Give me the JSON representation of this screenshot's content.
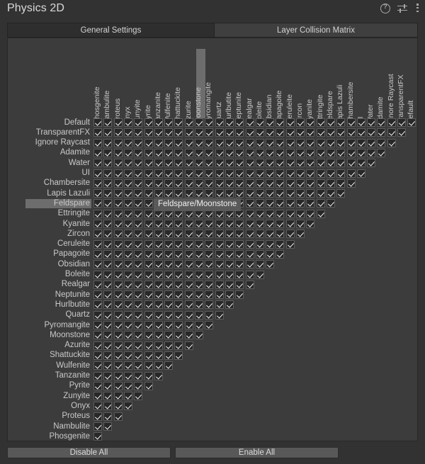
{
  "window": {
    "title": "Physics 2D",
    "icons": [
      {
        "name": "help-icon",
        "glyph": "?"
      },
      {
        "name": "preset-sliders-icon",
        "glyph": "sliders"
      },
      {
        "name": "more-options-kebab-icon",
        "glyph": "kebab"
      }
    ]
  },
  "tabs": [
    {
      "label": "General Settings",
      "active": false
    },
    {
      "label": "Layer Collision Matrix",
      "active": true
    }
  ],
  "matrix": {
    "row_labels": [
      "Default",
      "TransparentFX",
      "Ignore Raycast",
      "Adamite",
      "Water",
      "UI",
      "Chambersite",
      "Lapis Lazuli",
      "Feldspare",
      "Ettringite",
      "Kyanite",
      "Zircon",
      "Ceruleite",
      "Papagoite",
      "Obsidian",
      "Boleite",
      "Realgar",
      "Neptunite",
      "Hurlbutite",
      "Quartz",
      "Pyromangite",
      "Moonstone",
      "Azurite",
      "Shattuckite",
      "Wulfenite",
      "Tanzanite",
      "Pyrite",
      "Zunyite",
      "Onyx",
      "Proteus",
      "Nambulite",
      "Phosgenite"
    ],
    "column_labels": [
      "Phosgenite",
      "Nambulite",
      "Proteus",
      "Onyx",
      "Zunyite",
      "Pyrite",
      "Tanzanite",
      "Wulfenite",
      "Shattuckite",
      "Azurite",
      "Moonstone",
      "Pyromangite",
      "Quartz",
      "Hurlbutite",
      "Neptunite",
      "Realgar",
      "Boleite",
      "Obsidian",
      "Papagoite",
      "Ceruleite",
      "Zircon",
      "Kyanite",
      "Ettringite",
      "Feldspare",
      "Lapis Lazuli",
      "Chambersite",
      "UI",
      "Water",
      "Adamite",
      "Ignore Raycast",
      "TransparentFX",
      "Default"
    ],
    "all_checked": true,
    "highlighted_row": "Feldspare",
    "highlighted_column": "Moonstone",
    "tooltip": "Feldspare/Moonstone",
    "checkbox_state": "checked"
  },
  "footer": {
    "disable_all_label": "Disable All",
    "enable_all_label": "Enable All"
  },
  "colors": {
    "window_bg": "#323232",
    "panel_bg": "#3c3c3c",
    "tab_active": "#3f3f3f",
    "tab_inactive": "#2e2e2e",
    "highlight": "#6d6d6d",
    "checkbox_bg": "#282828",
    "text": "#c9c9c9",
    "button_bg": "#585858"
  }
}
